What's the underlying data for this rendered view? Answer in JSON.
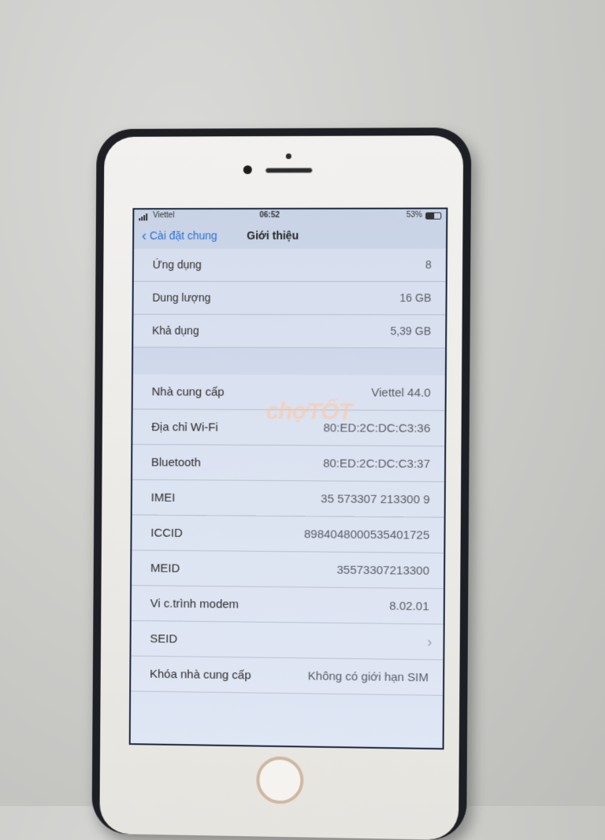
{
  "status": {
    "carrier": "Viettel",
    "time": "06:52",
    "battery": "53%",
    "battery_level": 0.53
  },
  "nav": {
    "back_label": "Cài đặt chung",
    "title": "Giới thiệu"
  },
  "group1": [
    {
      "label": "Ứng dụng",
      "value": "8"
    },
    {
      "label": "Dung lượng",
      "value": "16 GB"
    },
    {
      "label": "Khả dụng",
      "value": "5,39 GB"
    }
  ],
  "group2": [
    {
      "label": "Nhà cung cấp",
      "value": "Viettel 44.0"
    },
    {
      "label": "Địa chỉ Wi-Fi",
      "value": "80:ED:2C:DC:C3:36"
    },
    {
      "label": "Bluetooth",
      "value": "80:ED:2C:DC:C3:37"
    },
    {
      "label": "IMEI",
      "value": "35 573307 213300 9"
    },
    {
      "label": "ICCID",
      "value": "8984048000535401725"
    },
    {
      "label": "MEID",
      "value": "35573307213300"
    },
    {
      "label": "Vi c.trình modem",
      "value": "8.02.01"
    },
    {
      "label": "SEID",
      "value": ""
    },
    {
      "label": "Khóa nhà cung cấp",
      "value": "Không có giới hạn SIM"
    }
  ],
  "watermark": {
    "part1": "chợ",
    "part2": "TỐT"
  }
}
